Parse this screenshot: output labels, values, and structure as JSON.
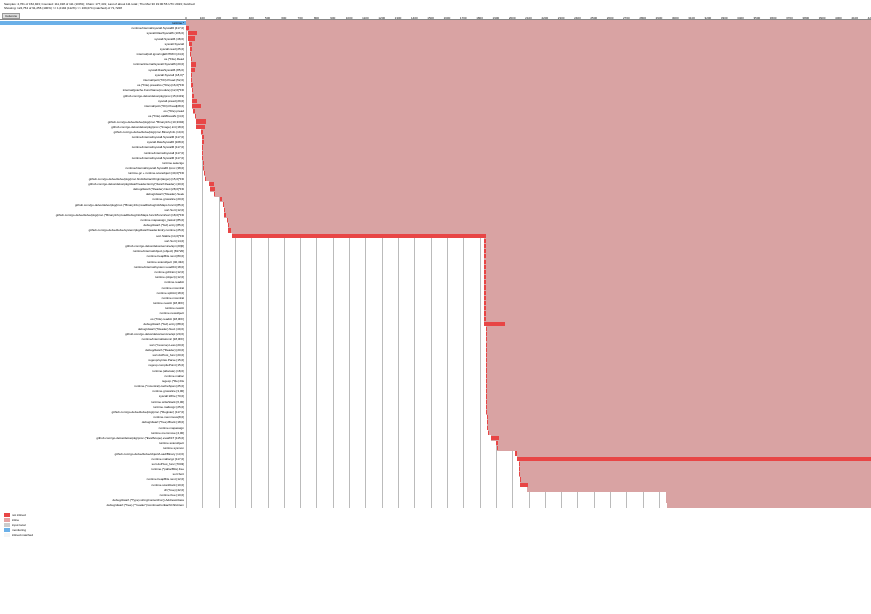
{
  "header": {
    "line1": "Samples: 4,761 of 152,923; Counted: 111,018 of 111 (100%); Chain: 177,431; Last of about 111 total:; Thu Mar 30 19:00:56 UTC 2023; Fetched:",
    "line2": "Showing: 124,754 of 91,256 (100%) >= 1,0194 (112%) >> 169,074 (matched) of 71,7228"
  },
  "columns_button": "Columns",
  "axis": {
    "start": 0,
    "end": 4200,
    "step": 100
  },
  "legend": [
    {
      "label": "not inlined",
      "color": "#e84545"
    },
    {
      "label": "inline",
      "color": "#e5a3a3"
    },
    {
      "label": "input local",
      "color": "#ccc"
    },
    {
      "label": "monitoring",
      "color": "#6bb0e8"
    },
    {
      "label": "inlined matched",
      "color": "#f5f5f5"
    }
  ],
  "chart_data": {
    "type": "bar",
    "title": "",
    "xlabel": "",
    "ylabel": "",
    "xlim": [
      0,
      4200
    ],
    "rows": [
      {
        "label": "runtime.*",
        "start": 0,
        "fg": 0,
        "bg": 4200,
        "highlighted": true
      },
      {
        "label": "runtime/internal/syscall.Syscall6 [417,0]",
        "start": 0,
        "fg": 20,
        "bg": 4200
      },
      {
        "label": "syscall.RawSyscall6 (106,0)",
        "start": 10,
        "fg": 55,
        "bg": 4190
      },
      {
        "label": "syscall.Syscall6 (48,0)",
        "start": 15,
        "fg": 40,
        "bg": 4185
      },
      {
        "label": "syscall.Syscall",
        "start": 20,
        "fg": 15,
        "bg": 4180
      },
      {
        "label": "syscall.read [25,0]",
        "start": 25,
        "fg": 10,
        "bg": 4175
      },
      {
        "label": "internal/poll.ignoringEINTRIO [24,0]",
        "start": 25,
        "fg": 8,
        "bg": 4175
      },
      {
        "label": "os.(*File).Read",
        "start": 28,
        "fg": 5,
        "bg": 4172
      },
      {
        "label": "runtime/internal/syscall.Syscall6 [20,0]",
        "start": 30,
        "fg": 30,
        "bg": 4170
      },
      {
        "label": "syscall.RawSyscall6 (85,0)",
        "start": 30,
        "fg": 25,
        "bg": 4170
      },
      {
        "label": "syscall.Syscall (18,0)*",
        "start": 30,
        "fg": 8,
        "bg": 4170
      },
      {
        "label": "internal/poll.(*FD).Pread (52,0)",
        "start": 30,
        "fg": 8,
        "bg": 4170
      },
      {
        "label": "os.(*File).pread/os.(*File).[16,0]*FD",
        "start": 30,
        "fg": 10,
        "bg": 4170
      },
      {
        "label": "internal/gcache.FuncName(module) [12,0]*FD",
        "start": 35,
        "fg": 5,
        "bg": 4165
      },
      {
        "label": "github.com/go-delve/delve/pkg/proc.[15,0419]",
        "start": 38,
        "fg": 10,
        "bg": 4162
      },
      {
        "label": "syscall.pread [29,0]",
        "start": 38,
        "fg": 30,
        "bg": 4162
      },
      {
        "label": "internal/poll.(*FD).Pread[28,0]",
        "start": 38,
        "fg": 55,
        "bg": 4162
      },
      {
        "label": "os.(*File).pread",
        "start": 45,
        "fg": 8,
        "bg": 4155
      },
      {
        "label": "os.(*File).call/ReadAt [(4,0]",
        "start": 55,
        "fg": 8,
        "bg": 4145
      },
      {
        "label": "github.com/go-delve/delve/pkg/proc.*BinaryInfo [10,3304]",
        "start": 60,
        "fg": 65,
        "bg": 4140
      },
      {
        "label": "github.com/go-delve/delve/pkg/proc.(*Image).init [18,0]",
        "start": 60,
        "fg": 55,
        "bg": 4140
      },
      {
        "label": "github.com/go-delve/delve/pkg/proc.BinaryInfo (10,0)",
        "start": 95,
        "fg": 10,
        "bg": 4105
      },
      {
        "label": "runtime/internal/syscall.Syscall6 [117,0]",
        "start": 100,
        "fg": 10,
        "bg": 4100
      },
      {
        "label": "syscall.RawSyscall6 [108,0]",
        "start": 100,
        "fg": 8,
        "bg": 4100
      },
      {
        "label": "runtime/internal/syscall.Syscall6 [117,0]",
        "start": 100,
        "fg": 5,
        "bg": 4100
      },
      {
        "label": "runtime/internal/syscall [117,0]",
        "start": 100,
        "fg": 5,
        "bg": 4100
      },
      {
        "label": "runtime/internal/syscall.Syscall6 [117,0]",
        "start": 100,
        "fg": 5,
        "bg": 4100
      },
      {
        "label": "runtime.selectgo",
        "start": 105,
        "fg": 5,
        "bg": 4095
      },
      {
        "label": "runtime/internal/syscall.Syscall6 /proc (38,0]",
        "start": 105,
        "fg": 8,
        "bg": 4095
      },
      {
        "label": "runtime.gc + runtime.scanobject [40,0]*FD",
        "start": 110,
        "fg": 5,
        "bg": 4090
      },
      {
        "label": "github.com/go-delve/delve/pkg/proc.findAbstractOrigin(target) [15,0]*FD",
        "start": 115,
        "fg": 5,
        "bg": 4085
      },
      {
        "label": "github.com/go-delve/delve/pkg/dwarf/reader.Entry(*dwarf.Reader) (40,0]",
        "start": 140,
        "fg": 30,
        "bg": 4060
      },
      {
        "label": "debug/dwarf.(*Reader).Next [28,0]*FD",
        "start": 150,
        "fg": 25,
        "bg": 4050
      },
      {
        "label": "debug/dwarf.(*Reader).Seek",
        "start": 170,
        "fg": 10,
        "bg": 4030
      },
      {
        "label": "runtime.growslice [20,0]",
        "start": 210,
        "fg": 10,
        "bg": 3990
      },
      {
        "label": "github.com/go-delve/delve/pkg/proc.(*BinaryInfo).loadDebugInfoMaps.func4 [85,0]",
        "start": 225,
        "fg": 8,
        "bg": 3975
      },
      {
        "label": "sort.Sort [12,0]",
        "start": 230,
        "fg": 8,
        "bg": 3970
      },
      {
        "label": "github.com/go-delve/delve/pkg/proc.(*BinaryInfo).loadDebugInfoMaps.func3/func4/sort [18,0]*FD",
        "start": 235,
        "fg": 8,
        "bg": 3965
      },
      {
        "label": "runtime.mapassign_faststr [85,0]",
        "start": 250,
        "fg": 8,
        "bg": 3950
      },
      {
        "label": "debug/dwarf.(*buf).entry [85,0]",
        "start": 255,
        "fg": 10,
        "bg": 3945
      },
      {
        "label": "github.com/go-delve/delve/system/pkg/dwarf/reader.Entry.runtime [25,0]",
        "start": 260,
        "fg": 15,
        "bg": 3940
      },
      {
        "label": "sort.Stable [14,0]*FD",
        "start": 280,
        "fg": 1560,
        "bg": 3920
      },
      {
        "label": "sort.Sort [14,0]",
        "start": 1830,
        "fg": 10,
        "bg": 2370
      },
      {
        "label": "github.com/go-delve/delve/service/api (20]0]",
        "start": 1830,
        "fg": 10,
        "bg": 2370
      },
      {
        "label": "runtime/internal/object,(object) [81720]",
        "start": 1830,
        "fg": 10,
        "bg": 2370
      },
      {
        "label": "runtime.heapBits.next [80,0]",
        "start": 1830,
        "fg": 10,
        "bg": 2370
      },
      {
        "label": "runtime.scanobject (40,432)",
        "start": 1830,
        "fg": 10,
        "bg": 2370
      },
      {
        "label": "runtime/internal/system.Load64 [18,0]",
        "start": 1830,
        "fg": 10,
        "bg": 2370
      },
      {
        "label": "runtime.gcDrain [12,0]",
        "start": 1830,
        "fg": 10,
        "bg": 2370
      },
      {
        "label": "runtime.(object) [12,0]",
        "start": 1830,
        "fg": 10,
        "bg": 2370
      },
      {
        "label": "runtime.readAt",
        "start": 1830,
        "fg": 8,
        "bg": 2370
      },
      {
        "label": "runtime.mcentral",
        "start": 1830,
        "fg": 8,
        "bg": 2370
      },
      {
        "label": "runtime.splitAt [18,0]",
        "start": 1830,
        "fg": 8,
        "bg": 2370
      },
      {
        "label": "runtime.mcentral",
        "start": 1830,
        "fg": 8,
        "bg": 2370
      },
      {
        "label": "runtime.newAt [18,0FF]",
        "start": 1830,
        "fg": 8,
        "bg": 2370
      },
      {
        "label": "runtime.newAt",
        "start": 1830,
        "fg": 8,
        "bg": 2370
      },
      {
        "label": "runtime.newobject",
        "start": 1830,
        "fg": 8,
        "bg": 2370
      },
      {
        "label": "os.(*File).readAt [18,0FF]",
        "start": 1830,
        "fg": 8,
        "bg": 2370
      },
      {
        "label": "debug/dwarf.(*buf).entry [88,0]",
        "start": 1830,
        "fg": 125,
        "bg": 2370
      },
      {
        "label": "debug/dwarf.(*Reader).Next (40,0)",
        "start": 1840,
        "fg": 8,
        "bg": 2360
      },
      {
        "label": "github.com/go-delve/delve/service/api (20,0)",
        "start": 1840,
        "fg": 8,
        "bg": 2360
      },
      {
        "label": "runtime/internal/atomic [18,0FF]",
        "start": 1840,
        "fg": 8,
        "bg": 2360
      },
      {
        "label": "sort.(*reverse).Less [20,0]",
        "start": 1840,
        "fg": 8,
        "bg": 2360
      },
      {
        "label": "debug/dwarf.(*Reader) [20,0]",
        "start": 1840,
        "fg": 8,
        "bg": 2360
      },
      {
        "label": "sort.doPivot_func [20,0]",
        "start": 1840,
        "fg": 8,
        "bg": 2360
      },
      {
        "label": "regexp/syntax.Parse [15,0]",
        "start": 1840,
        "fg": 8,
        "bg": 2360
      },
      {
        "label": "regexp.compilePoint [15,0]",
        "start": 1840,
        "fg": 8,
        "bg": 2360
      },
      {
        "label": "runtime.(allocate) (18,0)",
        "start": 1840,
        "fg": 8,
        "bg": 2360
      },
      {
        "label": "runtime.malloc",
        "start": 1840,
        "fg": 8,
        "bg": 2360
      },
      {
        "label": "regexp.(*Re).Dis",
        "start": 1840,
        "fg": 8,
        "bg": 2360
      },
      {
        "label": "runtime.(*mcentral).cacheSpan [25,0]",
        "start": 1840,
        "fg": 8,
        "bg": 2360
      },
      {
        "label": "runtime.growslice [3,00]",
        "start": 1840,
        "fg": 8,
        "bg": 2360
      },
      {
        "label": "syscall.Write [70,0]",
        "start": 1840,
        "fg": 8,
        "bg": 2360
      },
      {
        "label": "runtime.writeStack [6,00]",
        "start": 1840,
        "fg": 8,
        "bg": 2360
      },
      {
        "label": "runtime.mallocgc [25,0]",
        "start": 1840,
        "fg": 8,
        "bg": 2360
      },
      {
        "label": "github.com/go-delve/delve/pkg/proc.(*Register) [117,0]",
        "start": 1840,
        "fg": 8,
        "bg": 2360
      },
      {
        "label": "runtime.memmove[8,0]",
        "start": 1845,
        "fg": 8,
        "bg": 2355
      },
      {
        "label": "debug/dwarf.(*free).Block [18,0]",
        "start": 1845,
        "fg": 8,
        "bg": 2355
      },
      {
        "label": "runtime.mapassign",
        "start": 1845,
        "fg": 8,
        "bg": 2355
      },
      {
        "label": "runtime.memmove [4,00]",
        "start": 1850,
        "fg": 8,
        "bg": 2350
      },
      {
        "label": "github.com/go-delve/delve/pkg/proc.(*EvalScope).evalAST [115,0]",
        "start": 1870,
        "fg": 50,
        "bg": 2330
      },
      {
        "label": "runtime.scanobject",
        "start": 1900,
        "fg": 10,
        "bg": 2300
      },
      {
        "label": "runtime.sysmon",
        "start": 1905,
        "fg": 10,
        "bg": 2295
      },
      {
        "label": "github.com/go-delve/delve/object/Load/Binary (13,0)",
        "start": 2020,
        "fg": 8,
        "bg": 2180
      },
      {
        "label": "runtime.mallocgc [117,0]",
        "start": 2030,
        "fg": 2170,
        "bg": 2170
      },
      {
        "label": "sort.doPivot_func [7043]",
        "start": 2040,
        "fg": 10,
        "bg": 2160
      },
      {
        "label": "runtime.(*pallocBits).free",
        "start": 2040,
        "fg": 10,
        "bg": 2160
      },
      {
        "label": "sort.Sort",
        "start": 2040,
        "fg": 10,
        "bg": 2160
      },
      {
        "label": "runtime.heapBits.next [12,0]",
        "start": 2045,
        "fg": 10,
        "bg": 2155
      },
      {
        "label": "runtime.scanblock [10,0]",
        "start": 2050,
        "fg": 50,
        "bg": 2150
      },
      {
        "label": "df.(*tree) [42,0]",
        "start": 2090,
        "fg": 0,
        "bg": 2110
      },
      {
        "label": "runtime.free [10,0]",
        "start": 2940,
        "fg": 0,
        "bg": 1260
      },
      {
        "label": "debug/dwarf.(*Type).stringContentFor().AddressClass",
        "start": 2945,
        "fg": 0,
        "bg": 1255
      },
      {
        "label": "debug/dwarf.(*free).(\"*reader\")/continueForEachChild.item",
        "start": 2950,
        "fg": 0,
        "bg": 1250
      }
    ]
  }
}
